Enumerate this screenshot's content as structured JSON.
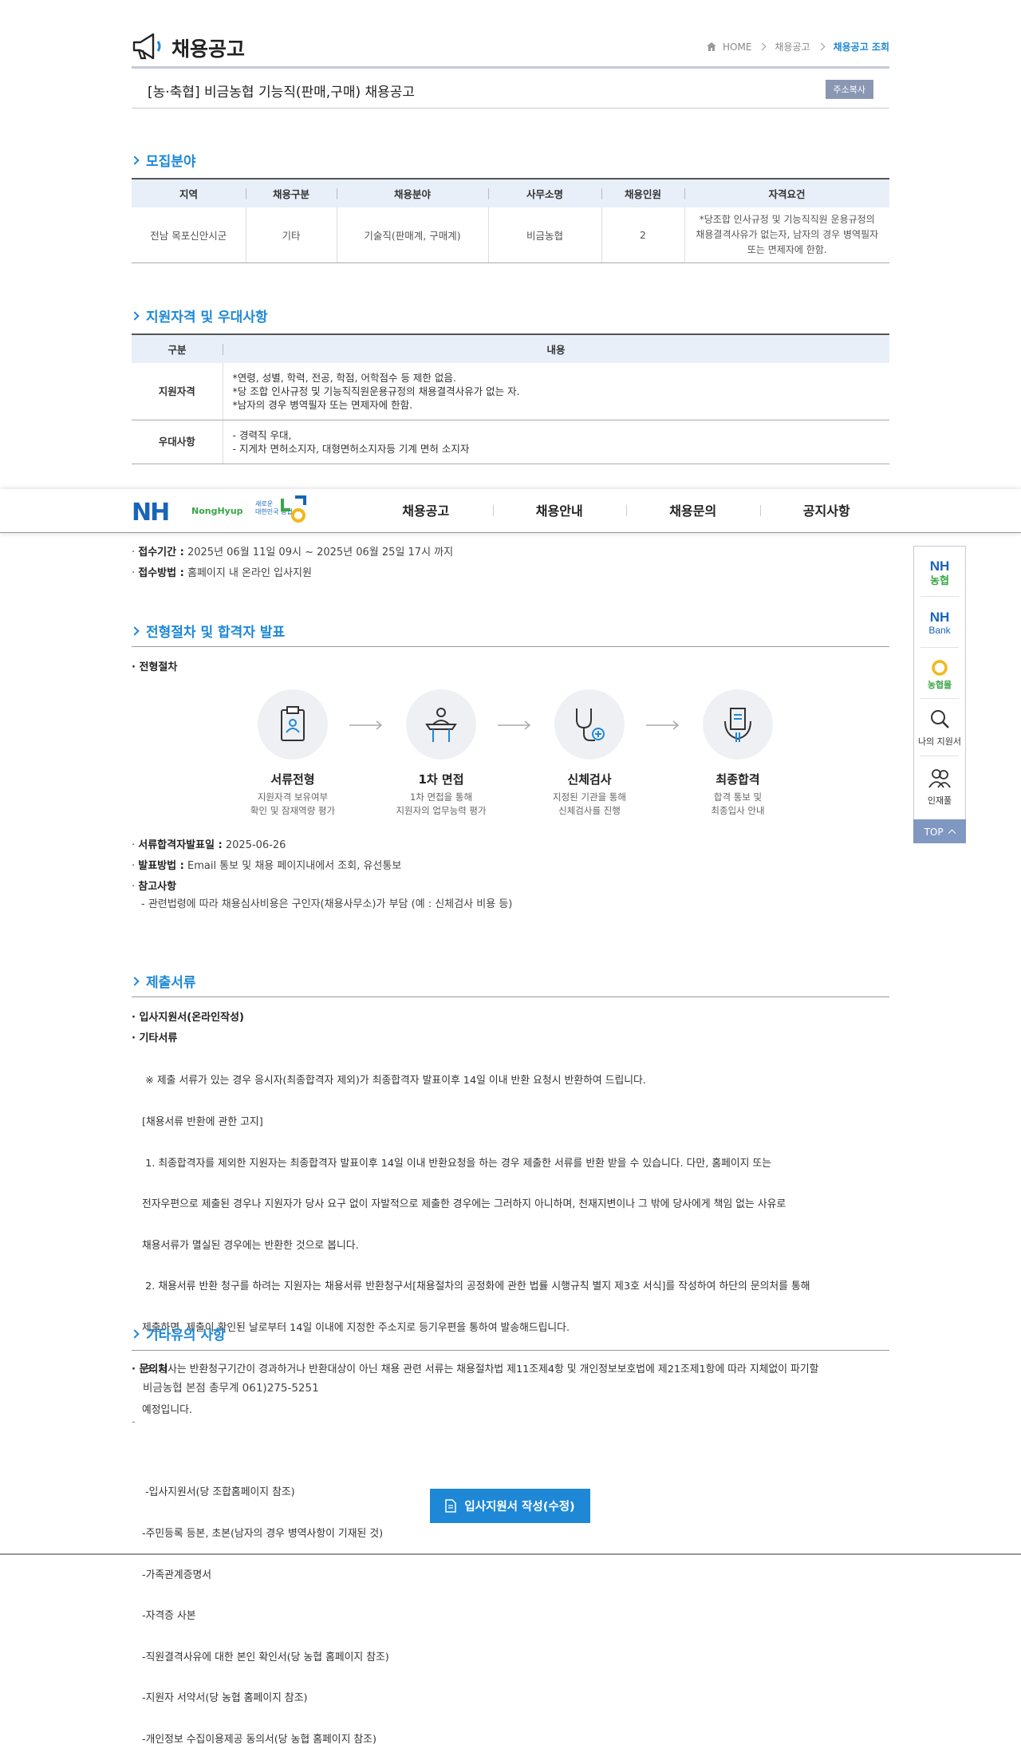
{
  "page": {
    "title": "채용공고",
    "breadcrumb": [
      "HOME",
      "채용공고",
      "채용공고 조회"
    ]
  },
  "job": {
    "title": "[농·축협] 비금농협 기능직(판매,구매) 채용공고",
    "copy_label": "주소복사"
  },
  "recruit": {
    "section_title": "모집분야",
    "headers": [
      "지역",
      "채용구분",
      "채용분야",
      "사무소명",
      "채용인원",
      "자격요건"
    ],
    "row": [
      "전남 목포신안시군",
      "기타",
      "기술직(판매계, 구매계)",
      "비금농협",
      "2"
    ],
    "qualification": [
      "*당조합 인사규정 및 기능직직원 운용규정의",
      "채용결격사유가 없는자, 남자의 경우 병역필자",
      "또는 면제자에 한함."
    ]
  },
  "eligibility": {
    "section_title": "지원자격 및 우대사항",
    "headers": [
      "구분",
      "내용"
    ],
    "rows": [
      {
        "label": "지원자격",
        "lines": [
          "*연령, 성별, 학력, 전공, 학점, 어학점수 등 제한 없음.",
          "*당 조합 인사규정 및 기능직직원운용규정의 채용결격사유가 없는 자.",
          "*남자의 경우 병역필자 또는 면제자에 한함."
        ]
      },
      {
        "label": "우대사항",
        "lines": [
          "- 경력직 우대,",
          "- 지게차 면허소지자, 대형면허소지자등 기계 면허 소지자"
        ]
      }
    ]
  },
  "navbar": {
    "logo": "NH",
    "logo_sub": "NongHyup",
    "slogan": [
      "새로운",
      "대한민국 농협"
    ],
    "items": [
      "채용공고",
      "채용안내",
      "채용문의",
      "공지사항"
    ]
  },
  "reception": {
    "period_label": "접수기간 :",
    "period_value": "2025년 06월 11일 09시 ~ 2025년 06월 25일 17시 까지",
    "method_label": "접수방법 :",
    "method_value": "홈페이지 내 온라인 입사지원"
  },
  "process": {
    "section_title": "전형절차 및 합격자 발표",
    "sub_label": "전형절차",
    "steps": [
      {
        "title": "서류전형",
        "desc": [
          "지원자격 보유여부",
          "확인 및 잠재역량 평가"
        ]
      },
      {
        "title": "1차 면접",
        "desc": [
          "1차 면접을 통해",
          "지원자의 업무능력 평가"
        ]
      },
      {
        "title": "신체검사",
        "desc": [
          "지정된 기관을 통해",
          "신체검사를 진행"
        ]
      },
      {
        "title": "최종합격",
        "desc": [
          "합격 통보 및",
          "최종입사 안내"
        ]
      }
    ],
    "announce_label": "서류합격자발표일 :",
    "announce_value": "2025-06-26",
    "notify_label": "발표방법 :",
    "notify_value": "Email 통보 및 채용 페이지내에서 조회, 유선통보",
    "note_label": "참고사항",
    "note_value": "- 관련법령에 따라 채용심사비용은 구인자(채용사무소)가 부담 (예 : 신체검사 비용 등)"
  },
  "documents": {
    "section_title": "제출서류",
    "online_label": "입사지원서(온라인작성)",
    "other_label": "기타서류",
    "lines": [
      " ※ 제출 서류가 있는 경우 응시자(최종합격자 제외)가 최종합격자 발표이후 14일 이내 반환 요청시 반환하여 드립니다.",
      "[채용서류 반환에 관한 고지]",
      " 1. 최종합격자를 제외한 지원자는 최종합격자 발표이후 14일 이내 반환요청을 하는 경우 제출한 서류를 반환 받을 수 있습니다. 다만, 홈페이지 또는",
      "전자우편으로 제출된 경우나 지원자가 당사 요구 없이 자발적으로 제출한 경우에는 그러하지 아니하며, 천재지변이나 그 밖에 당사에게 책임 없는 사유로",
      "채용서류가 멸실된 경우에는 반환한 것으로 봅니다.",
      " 2. 채용서류 반환 청구를 하려는 지원자는 채용서류 반환청구서[채용절차의 공정화에 관한 법률 시행규칙 별지 제3호 서식]를 작성하여 하단의 문의처를 통해",
      "제출하면, 제출이 확인된 날로부터 14일 이내에 지정한 주소지로 등기우편을 통하여 발송해드립니다.",
      " 3. 당사는 반환청구기간이 경과하거나 반환대상이 아닌 채용 관련 서류는 채용절차법 제11조제4항 및 개인정보보호법에 제21조제1항에 따라 지체없이 파기할",
      "예정입니다.",
      "",
      " -입사지원서(당 조합홈페이지 참조)",
      "-주민등록 등본, 초본(남자의 경우 병역사항이 기재된 것)",
      "-가족관계증명서",
      "-자격증 사본",
      "-직원결격사유에 대한 본인 확인서(당 농협 홈페이지 참조)",
      "-지원자 서약서(당 농협 홈페이지 참조)",
      "-개인정보 수집이용제공 동의서(당 농협 홈페이지 참조)"
    ]
  },
  "etc": {
    "section_title": "기타유의 사항",
    "contact_label": "문의처",
    "contact_value": "비금농협 본점 총무계 061)275-5251",
    "dash": "-"
  },
  "quick_menu": {
    "items": [
      {
        "icon": "nh-nonghyup-icon",
        "label": ""
      },
      {
        "icon": "nh-bank-icon",
        "label": ""
      },
      {
        "icon": "nonghyup-mall-icon",
        "label": ""
      },
      {
        "icon": "search-icon",
        "label": "나의 지원서"
      },
      {
        "icon": "people-icon",
        "label": "인재풀"
      }
    ],
    "logo_texts": {
      "nh": "NH",
      "nonghyup": "농협",
      "bank": "Bank",
      "mall": "농협몰"
    },
    "top_label": "TOP"
  },
  "apply_button": {
    "label": "입사지원서 작성(수정)"
  },
  "colors": {
    "accent": "#1e88d6",
    "header_bg": "#e8eff8",
    "brand_blue": "#1a64b8",
    "brand_green": "#3aa547",
    "top_btn": "#7f97c1"
  }
}
